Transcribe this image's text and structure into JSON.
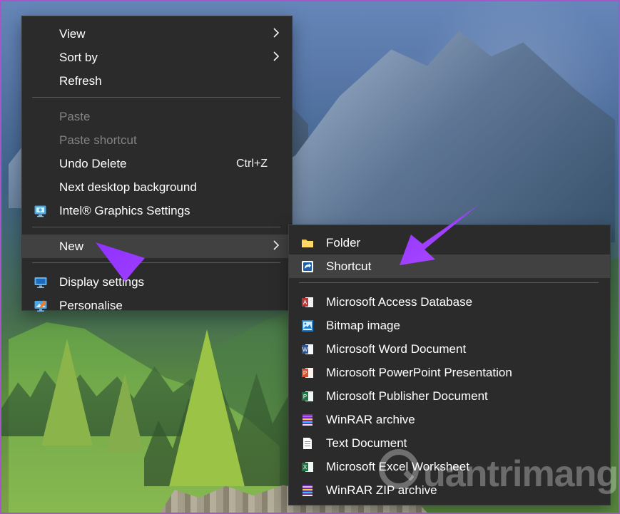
{
  "desktop": {
    "watermark_text": "uantrimang"
  },
  "context_menu": {
    "items": [
      {
        "label": "View",
        "has_submenu": true,
        "enabled": true,
        "icon": ""
      },
      {
        "label": "Sort by",
        "has_submenu": true,
        "enabled": true,
        "icon": ""
      },
      {
        "label": "Refresh",
        "has_submenu": false,
        "enabled": true,
        "icon": ""
      },
      {
        "label": "Paste",
        "has_submenu": false,
        "enabled": false,
        "icon": ""
      },
      {
        "label": "Paste shortcut",
        "has_submenu": false,
        "enabled": false,
        "icon": ""
      },
      {
        "label": "Undo Delete",
        "shortcut": "Ctrl+Z",
        "has_submenu": false,
        "enabled": true,
        "icon": ""
      },
      {
        "label": "Next desktop background",
        "has_submenu": false,
        "enabled": true,
        "icon": ""
      },
      {
        "label": "Intel® Graphics Settings",
        "has_submenu": false,
        "enabled": true,
        "icon": "intel-graphics-icon"
      },
      {
        "label": "New",
        "has_submenu": true,
        "enabled": true,
        "icon": "",
        "selected": true
      },
      {
        "label": "Display settings",
        "has_submenu": false,
        "enabled": true,
        "icon": "display-settings-icon"
      },
      {
        "label": "Personalise",
        "has_submenu": false,
        "enabled": true,
        "icon": "personalise-icon"
      }
    ]
  },
  "new_submenu": {
    "items": [
      {
        "label": "Folder",
        "icon": "folder-icon"
      },
      {
        "label": "Shortcut",
        "icon": "shortcut-icon",
        "selected": true
      },
      {
        "label": "Microsoft Access Database",
        "icon": "access-icon"
      },
      {
        "label": "Bitmap image",
        "icon": "bitmap-icon"
      },
      {
        "label": "Microsoft Word Document",
        "icon": "word-icon"
      },
      {
        "label": "Microsoft PowerPoint Presentation",
        "icon": "powerpoint-icon"
      },
      {
        "label": "Microsoft Publisher Document",
        "icon": "publisher-icon"
      },
      {
        "label": "WinRAR archive",
        "icon": "winrar-icon"
      },
      {
        "label": "Text Document",
        "icon": "text-document-icon"
      },
      {
        "label": "Microsoft Excel Worksheet",
        "icon": "excel-icon"
      },
      {
        "label": "WinRAR ZIP archive",
        "icon": "winrar-zip-icon"
      }
    ]
  },
  "colors": {
    "menu_background": "#2b2b2b",
    "menu_highlight": "#414141",
    "menu_text": "#ffffff",
    "menu_disabled_text": "#838383",
    "arrow_annotation": "#9b3df2",
    "frame_border": "#a657c8"
  }
}
